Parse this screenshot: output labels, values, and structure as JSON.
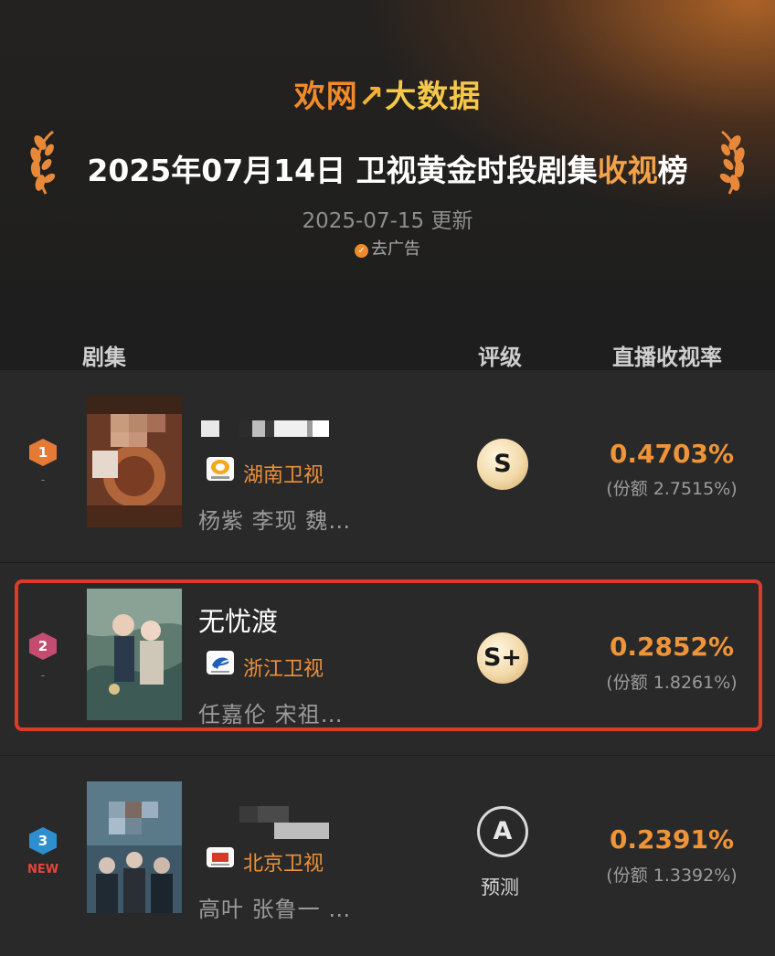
{
  "brand": {
    "part1": "欢网",
    "part2": "↗",
    "part3": "大数据"
  },
  "header": {
    "title_prefix": "2025年07月14日 卫视黄金时段剧集",
    "title_highlight": "收视",
    "title_suffix": "榜",
    "update": "2025-07-15 更新",
    "ad_check": "✓",
    "ad_label": "去广告"
  },
  "columns": {
    "series": "剧集",
    "grade": "评级",
    "rating": "直播收视率"
  },
  "rows": [
    {
      "rank": "1",
      "change": "-",
      "name": "",
      "network": "湖南卫视",
      "cast": "杨紫 李现 魏…",
      "grade": "S",
      "rating": "0.4703%",
      "share": "(份额 2.7515%)"
    },
    {
      "rank": "2",
      "change": "-",
      "name": "无忧渡",
      "network": "浙江卫视",
      "cast": "任嘉伦 宋祖…",
      "grade": "S+",
      "rating": "0.2852%",
      "share": "(份额 1.8261%)"
    },
    {
      "rank": "3",
      "change": "NEW",
      "name": "",
      "network": "北京卫视",
      "cast": "高叶 张鲁一 …",
      "grade": "A",
      "grade_note": "预测",
      "rating": "0.2391%",
      "share": "(份额 1.3392%)"
    }
  ],
  "colors": {
    "accent": "#ef9438",
    "highlight_border": "#dd3b2a",
    "background": "#1e1e1e"
  }
}
